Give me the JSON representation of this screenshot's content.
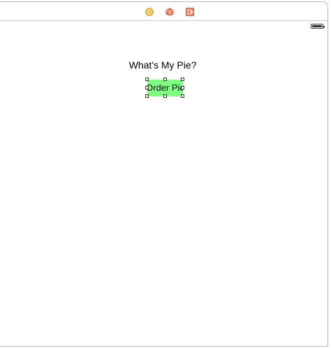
{
  "scene_dock": {
    "icons": [
      {
        "name": "view-controller-icon",
        "color": "#e8b84a"
      },
      {
        "name": "first-responder-icon",
        "color": "#e8623a"
      },
      {
        "name": "exit-icon",
        "color": "#e8623a"
      }
    ]
  },
  "view": {
    "status_bar": {
      "battery_icon": "battery-full-icon"
    },
    "question_label": "What's My Pie?",
    "order_button_label": "Order Pie",
    "order_button_color": "#80ff80"
  }
}
